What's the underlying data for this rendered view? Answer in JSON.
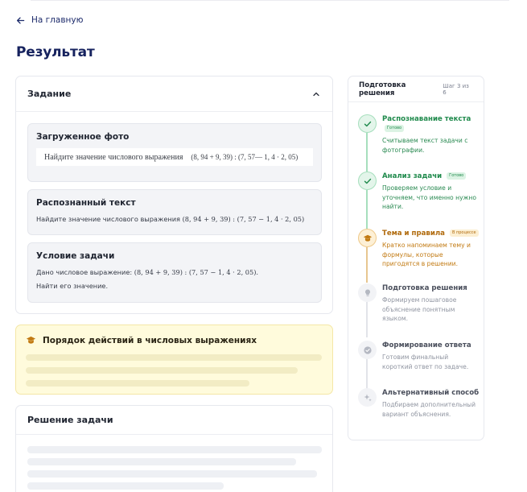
{
  "nav": {
    "back_label": "На главную"
  },
  "page": {
    "title": "Результат"
  },
  "task": {
    "title": "Задание",
    "photo": {
      "title": "Загруженное фото",
      "text": "Найдите значение числового выражения",
      "math": "(8, 94 + 9, 39) : (7, 57— 1, 4 · 2, 05)"
    },
    "recognized": {
      "title": "Распознанный текст",
      "text": "Найдите значение числового выражения",
      "math": "(8, 94 + 9, 39) : (7, 57 − 1, 4 · 2, 05)"
    },
    "condition": {
      "title": "Условие задачи",
      "text_prefix": "Дано числовое выражение:",
      "math": "(8, 94 + 9, 39) : (7, 57 − 1, 4 · 2, 05).",
      "text_2": "Найти его значение."
    }
  },
  "topic": {
    "title": "Порядок действий в числовых выражениях"
  },
  "solution": {
    "title": "Решение задачи"
  },
  "steps_panel": {
    "title": "Подготовка решения",
    "counter": "Шаг 3 из 6",
    "steps": [
      {
        "title": "Распознавание текста",
        "badge": "Готово",
        "desc": "Считываем текст задачи с фотографии.",
        "state": "done",
        "icon": "check-icon"
      },
      {
        "title": "Анализ задачи",
        "badge": "Готово",
        "desc": "Проверяем условие и уточняем, что именно нужно найти.",
        "state": "done",
        "icon": "check-icon"
      },
      {
        "title": "Тема и правила",
        "badge": "В процессе",
        "desc": "Кратко напоминаем тему и формулы, которые пригодятся в решении.",
        "state": "active",
        "icon": "graduation-cap-icon"
      },
      {
        "title": "Подготовка решения",
        "desc": "Формируем пошаговое объяснение понятным языком.",
        "state": "pending",
        "icon": "lightbulb-icon"
      },
      {
        "title": "Формирование ответа",
        "desc": "Готовим финальный короткий ответ по задаче.",
        "state": "pending",
        "icon": "check-circle-icon"
      },
      {
        "title": "Альтернативный способ",
        "desc": "Подбираем дополнительный вариант объяснения.",
        "state": "pending",
        "icon": "sparkles-icon"
      }
    ]
  },
  "colors": {
    "done": "#1f8a4c",
    "done_text": "#2a8a52",
    "active": "#c27a12",
    "pending": "#7a7f8c",
    "accent_title": "#16225e"
  }
}
